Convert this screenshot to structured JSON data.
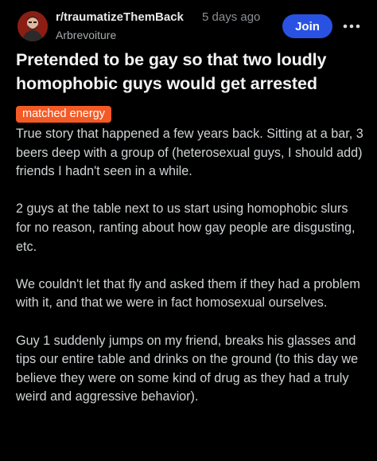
{
  "post": {
    "subreddit": "r/traumatizeThemBack",
    "time_ago": "5 days ago",
    "username": "Arbrevoiture",
    "join_label": "Join",
    "title": "Pretended to be gay so that two loudly homophobic guys would get arrested",
    "flair": "matched energy",
    "paragraphs": [
      "True story that happened a few years back. Sitting at a bar, 3 beers deep with a group of (heterosexual guys, I should add) friends I hadn't seen in a while.",
      "2 guys at the table next to us start using homophobic slurs for no reason, ranting about how gay people are disgusting, etc.",
      "We couldn't let that fly and asked them if they had a problem with it, and that we were in fact homosexual ourselves.",
      "Guy 1 suddenly jumps on my friend, breaks his glasses and tips our entire table and drinks on the ground (to this day we believe they were on some kind of drug as they had a truly weird and aggressive behavior)."
    ]
  },
  "icons": {
    "avatar": "subreddit-avatar-icon",
    "more": "more-options-icon"
  },
  "colors": {
    "background": "#000000",
    "join_button": "#2952e3",
    "flair": "#f45a25",
    "title_text": "#f3f4f5",
    "body_text": "#d0d3d5",
    "meta_text": "#8b8f93"
  }
}
